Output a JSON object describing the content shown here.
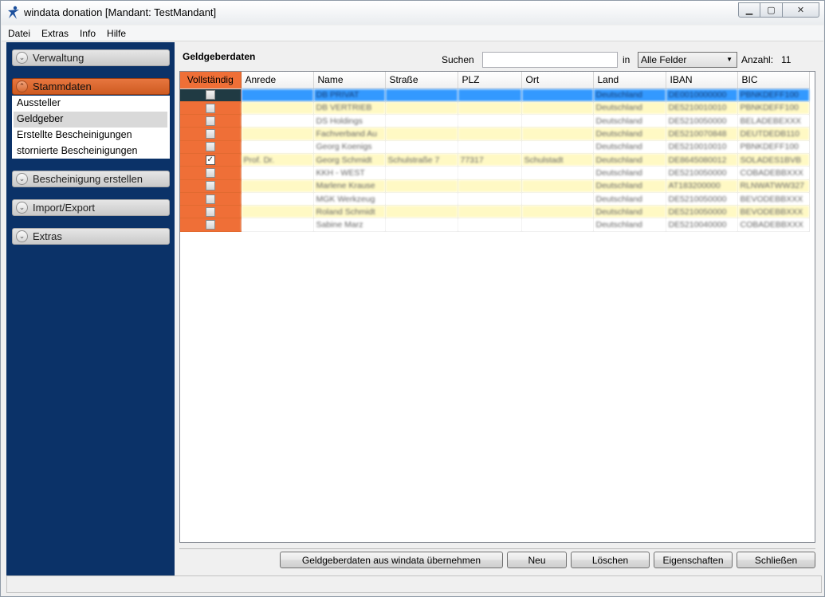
{
  "window": {
    "title": "windata donation [Mandant: TestMandant]",
    "controls": {
      "minimize": "▁",
      "maximize": "▢",
      "close": "✕"
    }
  },
  "menu": [
    "Datei",
    "Extras",
    "Info",
    "Hilfe"
  ],
  "nav": {
    "sections": [
      {
        "label": "Verwaltung",
        "state": "collapsed"
      },
      {
        "label": "Stammdaten",
        "state": "expanded"
      },
      {
        "label": "Bescheinigung erstellen",
        "state": "collapsed"
      },
      {
        "label": "Import/Export",
        "state": "collapsed"
      },
      {
        "label": "Extras",
        "state": "collapsed"
      }
    ],
    "stammdaten_items": [
      "Aussteller",
      "Geldgeber",
      "Erstellte Bescheinigungen",
      "stornierte Bescheinigungen"
    ],
    "selected_item": "Geldgeber",
    "chevron_down": "⌄",
    "chevron_up": "⌃"
  },
  "main": {
    "heading": "Geldgeberdaten",
    "search_label": "Suchen",
    "search_value": "",
    "in_label": "in",
    "field_select": "Alle Felder",
    "field_select_arrow": "▼",
    "count_label": "Anzahl:",
    "count_value": "11"
  },
  "table": {
    "columns": [
      "Vollständig",
      "Anrede",
      "Name",
      "Straße",
      "PLZ",
      "Ort",
      "Land",
      "IBAN",
      "BIC"
    ],
    "rows": [
      {
        "complete": false,
        "anrede": "",
        "name": "DB PRIVAT",
        "strasse": "",
        "plz": "",
        "ort": "",
        "land": "Deutschland",
        "iban": "DE0010000000",
        "bic": "PBNKDEFF100"
      },
      {
        "complete": false,
        "anrede": "",
        "name": "DB VERTRIEB",
        "strasse": "",
        "plz": "",
        "ort": "",
        "land": "Deutschland",
        "iban": "DE5210010010",
        "bic": "PBNKDEFF100"
      },
      {
        "complete": false,
        "anrede": "",
        "name": "DS Holdings",
        "strasse": "",
        "plz": "",
        "ort": "",
        "land": "Deutschland",
        "iban": "DE5210050000",
        "bic": "BELADEBEXXX"
      },
      {
        "complete": false,
        "anrede": "",
        "name": "Fachverband Au",
        "strasse": "",
        "plz": "",
        "ort": "",
        "land": "Deutschland",
        "iban": "DE5210070848",
        "bic": "DEUTDEDB110"
      },
      {
        "complete": false,
        "anrede": "",
        "name": "Georg Koenigs",
        "strasse": "",
        "plz": "",
        "ort": "",
        "land": "Deutschland",
        "iban": "DE5210010010",
        "bic": "PBNKDEFF100"
      },
      {
        "complete": true,
        "anrede": "Prof. Dr.",
        "name": "Georg Schmidt",
        "strasse": "Schulstraße 7",
        "plz": "77317",
        "ort": "Schulstadt",
        "land": "Deutschland",
        "iban": "DE8645080012",
        "bic": "SOLADES1BVB"
      },
      {
        "complete": false,
        "anrede": "",
        "name": "KKH - WEST",
        "strasse": "",
        "plz": "",
        "ort": "",
        "land": "Deutschland",
        "iban": "DE5210050000",
        "bic": "COBADEBBXXX"
      },
      {
        "complete": false,
        "anrede": "",
        "name": "Marlene Krause",
        "strasse": "",
        "plz": "",
        "ort": "",
        "land": "Deutschland",
        "iban": "AT183200000",
        "bic": "RLNWATWW327"
      },
      {
        "complete": false,
        "anrede": "",
        "name": "MGK Werkzeug",
        "strasse": "",
        "plz": "",
        "ort": "",
        "land": "Deutschland",
        "iban": "DE5210050000",
        "bic": "BEVODEBBXXX"
      },
      {
        "complete": false,
        "anrede": "",
        "name": "Roland Schmidt",
        "strasse": "",
        "plz": "",
        "ort": "",
        "land": "Deutschland",
        "iban": "DE5210050000",
        "bic": "BEVODEBBXXX"
      },
      {
        "complete": false,
        "anrede": "",
        "name": "Sabine Marz",
        "strasse": "",
        "plz": "",
        "ort": "",
        "land": "Deutschland",
        "iban": "DE5210040000",
        "bic": "COBADEBBXXX"
      }
    ],
    "selected_row": 0
  },
  "buttons": {
    "import": "Geldgeberdaten aus windata übernehmen",
    "new": "Neu",
    "delete": "Löschen",
    "properties": "Eigenschaften",
    "close": "Schließen"
  },
  "colors": {
    "nav_bg": "#0b3268",
    "accent_orange": "#ef6f37",
    "row_highlight": "#fff9c4",
    "selection": "#3399ff"
  }
}
